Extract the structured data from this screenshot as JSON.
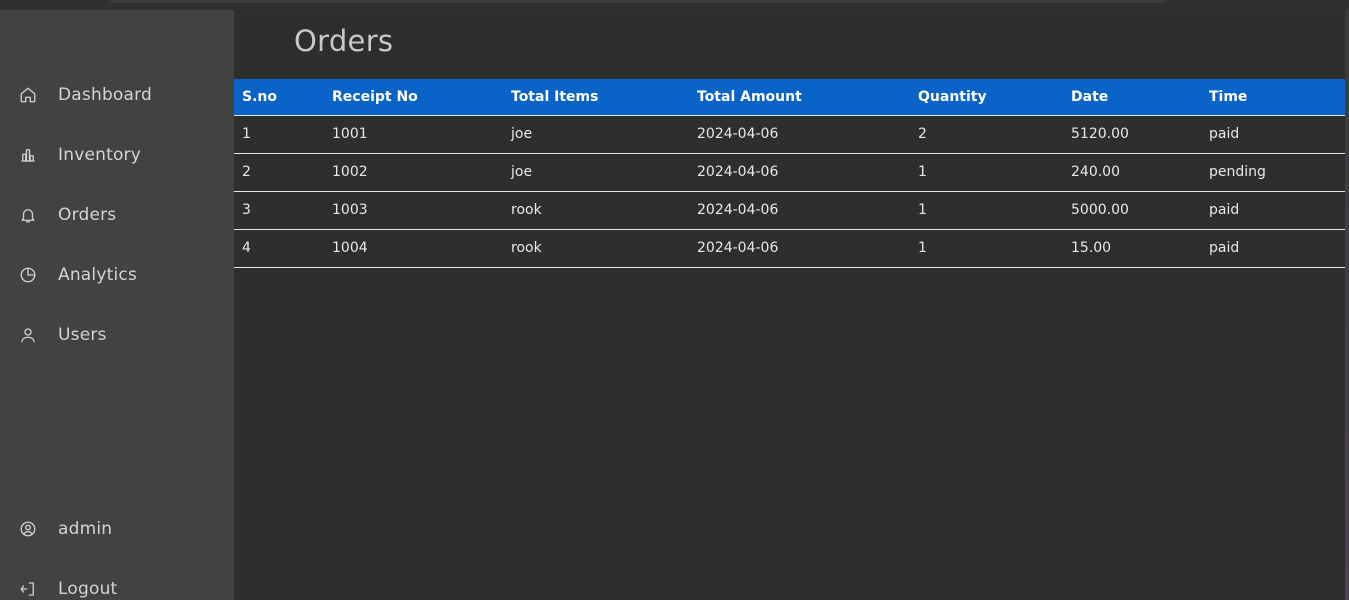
{
  "app": {
    "page_title": "Orders"
  },
  "sidebar": {
    "items": [
      {
        "label": "Dashboard",
        "icon": "home-icon"
      },
      {
        "label": "Inventory",
        "icon": "bar-chart-icon"
      },
      {
        "label": "Orders",
        "icon": "bell-icon"
      },
      {
        "label": "Analytics",
        "icon": "pie-chart-icon"
      },
      {
        "label": "Users",
        "icon": "user-icon"
      }
    ],
    "account": {
      "label": "admin",
      "icon": "user-circle-icon"
    },
    "logout": {
      "label": "Logout",
      "icon": "logout-icon"
    }
  },
  "table": {
    "columns": [
      "S.no",
      "Receipt No",
      "Total Items",
      "Total Amount",
      "Quantity",
      "Date",
      "Time"
    ],
    "rows": [
      [
        "1",
        "1001",
        "joe",
        "2024-04-06",
        "2",
        "5120.00",
        "paid"
      ],
      [
        "2",
        "1002",
        "joe",
        "2024-04-06",
        "1",
        "240.00",
        "pending"
      ],
      [
        "3",
        "1003",
        "rook",
        "2024-04-06",
        "1",
        "5000.00",
        "paid"
      ],
      [
        "4",
        "1004",
        "rook",
        "2024-04-06",
        "1",
        "15.00",
        "paid"
      ]
    ]
  },
  "colors": {
    "header_blue": "#0a64c8",
    "sidebar_bg": "#424242",
    "main_bg": "#2e2e2e"
  }
}
